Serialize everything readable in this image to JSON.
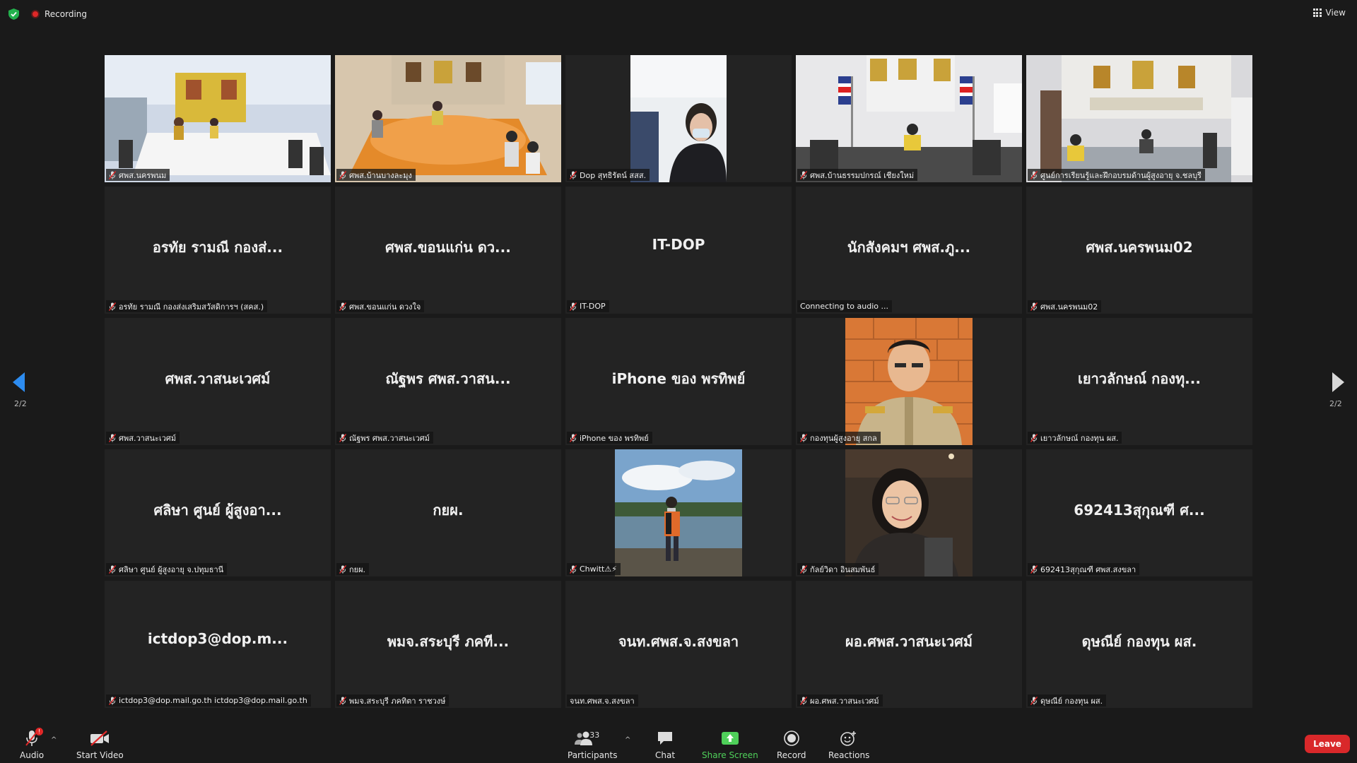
{
  "top": {
    "recording": "Recording",
    "view": "View"
  },
  "tiles": [
    {
      "type": "video",
      "video": "room-yellow",
      "label": "ศพส.นครพนม"
    },
    {
      "type": "video",
      "video": "room-orange",
      "label": "ศพส.บ้านบางละมุง"
    },
    {
      "type": "video",
      "video": "person-mask",
      "label": "Dop สุทธิรัตน์ สสส."
    },
    {
      "type": "video",
      "video": "room-flags",
      "label": "ศพส.บ้านธรรมปกรณ์ เชียงใหม่"
    },
    {
      "type": "video",
      "video": "room-banner",
      "label": "ศูนย์การเรียนรู้และฝึกอบรมด้านผู้สูงอายุ จ.ชลบุรี"
    },
    {
      "type": "name",
      "display": "อรทัย รามณี กองส่...",
      "label": "อรทัย รามณี กองส่งเสริมสวัสดิการฯ (สคส.)"
    },
    {
      "type": "name",
      "display": "ศพส.ขอนแก่น ดว...",
      "label": "ศพส.ขอนแก่น ดวงใจ"
    },
    {
      "type": "name",
      "display": "IT-DOP",
      "label": "IT-DOP"
    },
    {
      "type": "name",
      "display": "นักสังคมฯ ศพส.ภู...",
      "label": "Connecting to audio ...",
      "no_mute": true
    },
    {
      "type": "name",
      "display": "ศพส.นครพนม02",
      "label": "ศพส.นครพนม02"
    },
    {
      "type": "name",
      "display": "ศพส.วาสนะเวศม์",
      "label": "ศพส.วาสนะเวศม์"
    },
    {
      "type": "name",
      "display": "ณัฐพร ศพส.วาสน...",
      "label": "ณัฐพร ศพส.วาสนะเวศม์"
    },
    {
      "type": "name",
      "display": "iPhone ของ พรทิพย์",
      "label": "iPhone ของ พรทิพย์"
    },
    {
      "type": "video",
      "video": "officer",
      "label": "กองทุนผู้สูงอายุ สกล"
    },
    {
      "type": "name",
      "display": "เยาวลักษณ์ กองทุ...",
      "label": "เยาวลักษณ์ กองทุน ผส."
    },
    {
      "type": "name",
      "display": "ศลิษา ศูนย์ ผู้สูงอา...",
      "label": "ศลิษา ศูนย์ ผู้สูงอายุ จ.ปทุมธานี"
    },
    {
      "type": "name",
      "display": "กยผ.",
      "label": "กยผ."
    },
    {
      "type": "video",
      "video": "outdoor",
      "label": "Chwitt⚠⚡"
    },
    {
      "type": "video",
      "video": "woman",
      "label": "กัลย์วิดา อินสมพันธ์"
    },
    {
      "type": "name",
      "display": "692413สุกุณฑี ศ...",
      "label": "692413สุกุณฑี ศพส.สงขลา"
    },
    {
      "type": "name",
      "display": "ictdop3@dop.m...",
      "label": "ictdop3@dop.mail.go.th ictdop3@dop.mail.go.th"
    },
    {
      "type": "name",
      "display": "พมจ.สระบุรี ภคที...",
      "label": "พมจ.สระบุรี ภคทิตา ราชวงษ์"
    },
    {
      "type": "name",
      "display": "จนท.ศพส.จ.สงขลา",
      "label": "จนท.ศพส.จ.สงขลา",
      "no_mute": true
    },
    {
      "type": "name",
      "display": "ผอ.ศพส.วาสนะเวศม์",
      "label": "ผอ.ศพส.วาสนะเวศม์"
    },
    {
      "type": "name",
      "display": "ดุษณีย์ กองทุน ผส.",
      "label": "ดุษณีย์ กองทุน ผส."
    }
  ],
  "pager": {
    "left": "2/2",
    "right": "2/2"
  },
  "toolbar": {
    "audio": "Audio",
    "start_video": "Start Video",
    "participants": "Participants",
    "participants_count": "33",
    "chat": "Chat",
    "share_screen": "Share Screen",
    "record": "Record",
    "reactions": "Reactions",
    "leave": "Leave",
    "audio_badge": "!"
  },
  "colors": {
    "accent_green": "#4fd05a",
    "leave_red": "#d9282a",
    "recording_red": "#e02828",
    "arrow_blue": "#2d8cf0"
  }
}
